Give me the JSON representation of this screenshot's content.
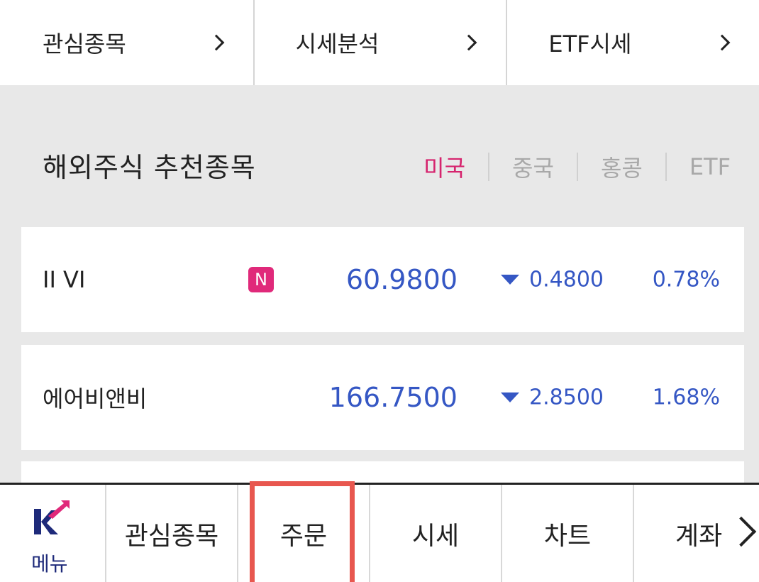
{
  "top_nav": {
    "items": [
      {
        "label": "관심종목"
      },
      {
        "label": "시세분석"
      },
      {
        "label": "ETF시세"
      }
    ]
  },
  "section": {
    "title": "해외주식 추천종목",
    "region_tabs": [
      {
        "label": "미국",
        "active": true
      },
      {
        "label": "중국",
        "active": false
      },
      {
        "label": "홍콩",
        "active": false
      },
      {
        "label": "ETF",
        "active": false
      }
    ]
  },
  "stocks": [
    {
      "name": "II VI",
      "badge": "N",
      "price": "60.9800",
      "change": "0.4800",
      "change_pct": "0.78%",
      "direction": "down"
    },
    {
      "name": "에어비앤비",
      "price": "166.7500",
      "change": "2.8500",
      "change_pct": "1.68%",
      "direction": "down"
    }
  ],
  "bottom_bar": {
    "menu_label": "메뉴",
    "tabs": [
      {
        "label": "관심종목"
      },
      {
        "label": "주문"
      },
      {
        "label": "시세"
      },
      {
        "label": "차트"
      },
      {
        "label": "계좌"
      }
    ]
  },
  "colors": {
    "accent_pink": "#d6246e",
    "price_blue": "#3557c4",
    "highlight_red": "#e8574f",
    "brand_navy": "#1e2a7a"
  }
}
